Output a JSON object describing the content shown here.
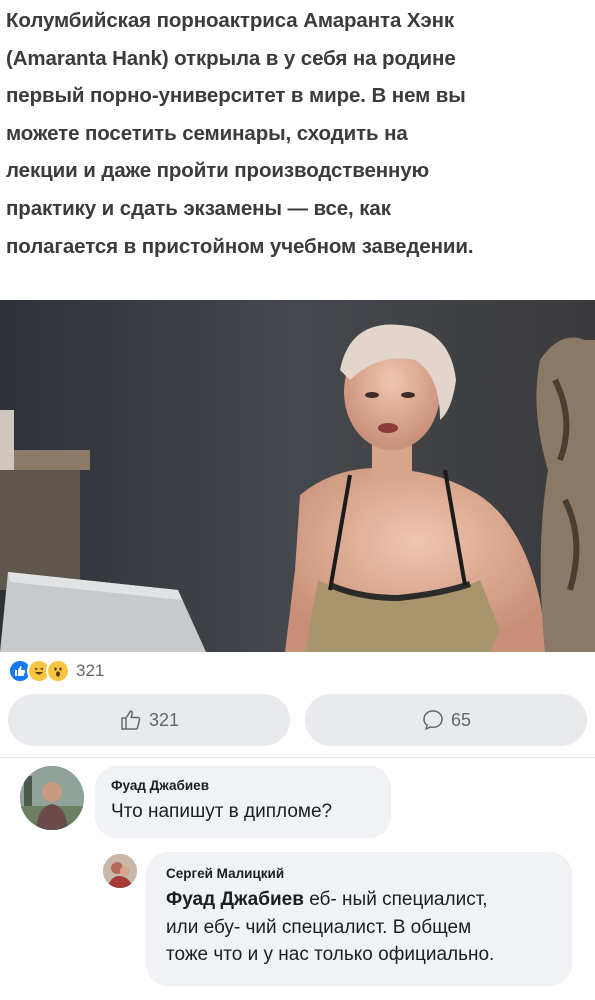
{
  "post": {
    "text_lines": [
      "Колумбийская порноактриса Амаранта Хэнк",
      "(Amaranta Hank) открыла в у себя на родине",
      "первый порно-университет в мире. В нем вы",
      "можете посетить семинары, сходить на",
      "лекции и даже пройти производственную",
      "практику и сдать экзамены — все, как",
      "полагается в пристойном учебном заведении."
    ]
  },
  "reactions": {
    "icons": [
      "like-icon",
      "haha-icon",
      "wow-icon"
    ],
    "count": "321"
  },
  "actions": {
    "like_count": "321",
    "comment_count": "65"
  },
  "comments": [
    {
      "author": "Фуад Джабиев",
      "text": "Что напишут в дипломе?"
    },
    {
      "author": "Сергей Малицкий",
      "mention": "Фуад Джабиев",
      "text_line1": " еб- ный специалист,",
      "text_line2": "или ебу- чий специалист. В общем",
      "text_line3": "тоже что и у нас только официально."
    }
  ],
  "colors": {
    "like_blue": "#1877f2",
    "bubble_gray": "#f0f2f5",
    "button_gray": "#e8eaed",
    "muted_text": "#65676b"
  }
}
